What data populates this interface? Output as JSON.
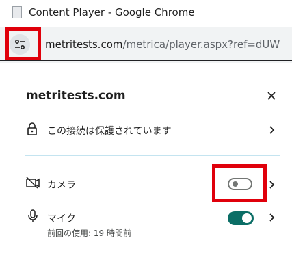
{
  "window": {
    "title": "Content Player - Google Chrome"
  },
  "address_bar": {
    "url_domain": "metritests.com",
    "url_path": "/metrica/player.aspx?ref=dUW"
  },
  "site_panel": {
    "domain": "metritests.com",
    "connection_label": "この接続は保護されています",
    "permissions": [
      {
        "name": "camera",
        "label": "カメラ",
        "enabled": false,
        "icon": "camera-off-icon"
      },
      {
        "name": "mic",
        "label": "マイク",
        "sub_label": "前回の使用: 19 時間前",
        "enabled": true,
        "icon": "microphone-icon"
      }
    ]
  },
  "colors": {
    "highlight": "#e0000b",
    "toggle_on": "#0b6e66",
    "toggle_off_border": "#747775",
    "address_bar_bg": "#f1f3f4"
  }
}
